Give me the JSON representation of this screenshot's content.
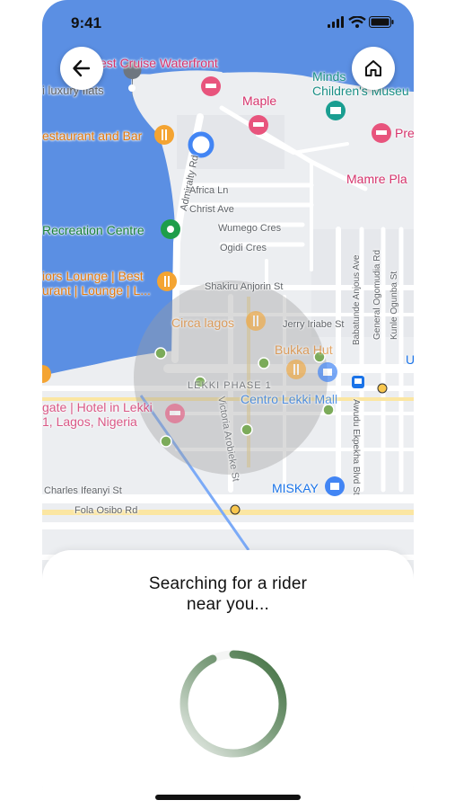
{
  "status_bar": {
    "time": "9:41"
  },
  "map": {
    "pois": {
      "cruise": "est Cruise Waterfront",
      "luxury_flats": "i luxury flats",
      "maple": "Maple",
      "minds_1": "Minds",
      "minds_2": "Children's Museu",
      "restaurant_bar": "estaurant and Bar",
      "pre": "Pre",
      "mamre": "Mamre Pla",
      "recreation": "Recreation Centre",
      "lounge_1": "iors Lounge | Best",
      "lounge_2": "urant | Lounge | L...",
      "circa": "Circa lagos",
      "bukka": "Bukka Hut",
      "lekki_phase": "LEKKI PHASE 1",
      "centro": "Centro Lekki Mall",
      "hotel_1": "gate | Hotel in Lekki",
      "hotel_2": "1, Lagos, Nigeria",
      "miskay": "MISKAY",
      "u": "U"
    },
    "streets": {
      "admiralty": "Admiralty Rd",
      "africa": "Africa Ln",
      "christ": "Christ Ave",
      "wumego": "Wumego Cres",
      "ogidi": "Ogidi Cres",
      "shakiru": "Shakiru Anjorin St",
      "jerry": "Jerry Iriabe St",
      "victoria": "Victoria Arobieke St",
      "babatunde": "Babatunde Anjous Ave",
      "general": "General Ogomudia Rd",
      "kunle": "Kunle Ogunba St",
      "awudu": "Awudu Ekpekha Blvd St",
      "charles": "Charles Ifeanyi St",
      "fola": "Fola Osibo Rd"
    }
  },
  "sheet": {
    "title_line1": "Searching for a rider",
    "title_line2": "near you..."
  },
  "colors": {
    "water": "#5b8fe3",
    "accent_green": "#4f7a4f",
    "rider_dot": "#7cab5a",
    "location_blue": "#4285f4"
  },
  "icons": {
    "back": "arrow-left-icon",
    "home": "home-icon"
  }
}
